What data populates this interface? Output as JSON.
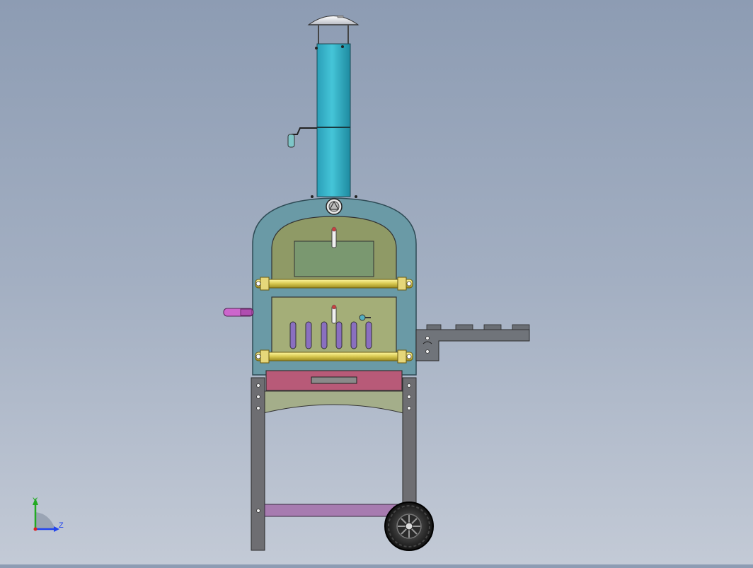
{
  "viewport": {
    "background_top": "#8d9cb3",
    "background_bottom": "#c3cad6"
  },
  "triad": {
    "y_label": "Y",
    "z_label": "Z",
    "y_color": "#22aa22",
    "z_color": "#2244ee",
    "x_color": "#dd2222"
  },
  "model": {
    "chimney_color": "#33b0c6",
    "oven_body_color": "#6a9aa6",
    "upper_door_color": "#8f9a66",
    "lower_door_color": "#a4ae78",
    "rail_color": "#e0d060",
    "drawer_color": "#b85a78",
    "apron_color": "#a4ae8a",
    "leg_color": "#6e6e72",
    "crossbar_color": "#a77bb0",
    "side_handle_color": "#cc66cc",
    "side_shelf_color": "#70747a",
    "wheel_color": "#1a1a1a"
  }
}
